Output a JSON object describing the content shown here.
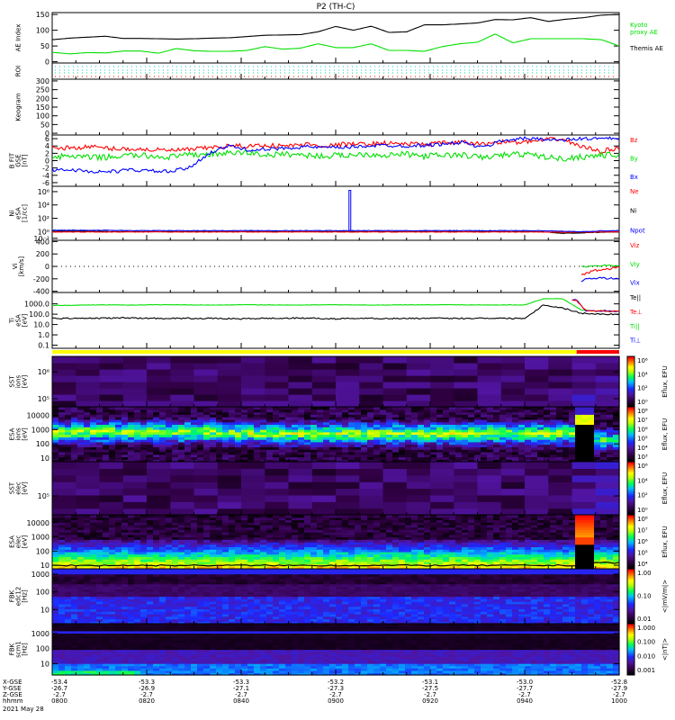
{
  "title": "P2 (TH-C)",
  "colors": {
    "red": "#ff0000",
    "green": "#00e000",
    "blue": "#0000ff",
    "black": "#000000",
    "yellow": "#ffff00",
    "cyan": "#00d0d0"
  },
  "chart_data": [
    {
      "id": "ae",
      "type": "line",
      "ylabel": "AE Index",
      "ylim": [
        -4,
        156
      ],
      "log": false,
      "ticks": [
        {
          "v": 0,
          "l": "0"
        },
        {
          "v": 50,
          "l": "50"
        },
        {
          "v": 100,
          "l": "100"
        },
        {
          "v": 150,
          "l": "150"
        }
      ],
      "legend": [
        {
          "name": "Kyoto proxy AE",
          "lines": [
            "Kyoto",
            "proxy AE"
          ],
          "color": "#00e000"
        },
        {
          "name": "Themis AE",
          "lines": [
            "Themis AE"
          ],
          "color": "#000000"
        }
      ],
      "series": [
        {
          "name": "Themis AE",
          "color": "#000000",
          "values": [
            70,
            75,
            78,
            81,
            74,
            74,
            73,
            72,
            73,
            75,
            76,
            80,
            84,
            85,
            86,
            95,
            112,
            100,
            113,
            93,
            95,
            117,
            117,
            120,
            123,
            134,
            133,
            140,
            128,
            135,
            140,
            148,
            150
          ]
        },
        {
          "name": "Kyoto proxy AE",
          "color": "#00e000",
          "values": [
            30,
            25,
            29,
            28,
            34,
            34,
            27,
            42,
            35,
            33,
            33,
            36,
            48,
            40,
            43,
            57,
            45,
            45,
            57,
            36,
            36,
            33,
            48,
            57,
            62,
            88,
            60,
            73,
            73,
            73,
            73,
            70,
            50
          ]
        }
      ]
    },
    {
      "id": "roi",
      "type": "line",
      "ylabel": "ROI",
      "ticks": []
    },
    {
      "id": "keo",
      "type": "line",
      "ylabel": "Keogram",
      "ylim": [
        -10,
        310
      ],
      "log": false,
      "ticks": [
        {
          "v": 0,
          "l": "0"
        },
        {
          "v": 50,
          "l": "50"
        },
        {
          "v": 100,
          "l": "100"
        },
        {
          "v": 150,
          "l": "150"
        },
        {
          "v": 200,
          "l": "200"
        },
        {
          "v": 250,
          "l": "250"
        },
        {
          "v": 300,
          "l": "300"
        }
      ],
      "series": []
    },
    {
      "id": "b",
      "type": "line",
      "ylabel": [
        "B FIT",
        "GSE",
        "[nT]"
      ],
      "ylim": [
        -7,
        7
      ],
      "log": false,
      "ticks": [
        {
          "v": -6,
          "l": "-6"
        },
        {
          "v": -4,
          "l": "-4"
        },
        {
          "v": -2,
          "l": "-2"
        },
        {
          "v": 0,
          "l": "0"
        },
        {
          "v": 2,
          "l": "2"
        },
        {
          "v": 4,
          "l": "4"
        },
        {
          "v": 6,
          "l": "6"
        }
      ],
      "legend": [
        {
          "name": "Bz",
          "lines": [
            "Bz"
          ],
          "color": "#ff0000"
        },
        {
          "name": "By",
          "lines": [
            "By"
          ],
          "color": "#00e000"
        },
        {
          "name": "Bx",
          "lines": [
            "Bx"
          ],
          "color": "#0000ff"
        }
      ],
      "series": [
        {
          "name": "Bz",
          "color": "#ff0000",
          "noise": 0.6,
          "values": [
            3.5,
            3.5,
            3.8,
            3.3,
            3.2,
            3.0,
            2.8,
            3.0,
            3.5,
            4.0,
            4.0,
            4.2,
            4.0,
            4.5,
            4.0,
            4.5,
            4.5,
            4.8,
            4.6,
            4.5,
            4.8,
            5.0,
            4.5,
            5.2,
            5.0,
            5.5,
            6.0,
            4.0,
            2.5,
            3.5
          ]
        },
        {
          "name": "By",
          "color": "#00e000",
          "noise": 0.8,
          "values": [
            1.0,
            1.2,
            0.8,
            1.0,
            1.5,
            1.2,
            1.0,
            1.5,
            1.8,
            2.0,
            2.2,
            1.5,
            1.8,
            1.5,
            1.2,
            1.5,
            1.8,
            1.5,
            1.8,
            1.2,
            1.5,
            1.5,
            0.8,
            1.5,
            1.8,
            1.2,
            0.5,
            1.0,
            1.5,
            1.5
          ]
        },
        {
          "name": "Bx",
          "color": "#0000ff",
          "noise": 0.5,
          "values": [
            -2.5,
            -2.5,
            -3.0,
            -3.0,
            -2.5,
            -2.8,
            -3.0,
            -2.0,
            2.0,
            4.0,
            3.0,
            3.0,
            3.5,
            3.8,
            3.5,
            3.6,
            4.0,
            4.2,
            4.0,
            4.2,
            4.5,
            5.0,
            3.5,
            5.5,
            6.0,
            6.0,
            5.5,
            6.0,
            6.0,
            6.0
          ]
        }
      ]
    },
    {
      "id": "ni",
      "type": "line",
      "ylabel": [
        "Ni",
        "eSA",
        "[1/cc]"
      ],
      "ylim": [
        -1.3,
        6.8
      ],
      "log": true,
      "ticks": [
        {
          "v": -1,
          "l": "10⁻¹"
        },
        {
          "v": 0,
          "l": "10⁰"
        },
        {
          "v": 2,
          "l": "10²"
        },
        {
          "v": 4,
          "l": "10⁴"
        },
        {
          "v": 6,
          "l": "10⁶"
        }
      ],
      "legend": [
        {
          "name": "Ne",
          "lines": [
            "Ne"
          ],
          "color": "#ff0000"
        },
        {
          "name": "Ni",
          "lines": [
            "Ni"
          ],
          "color": "#000000"
        },
        {
          "name": "Npot",
          "lines": [
            "Npot"
          ],
          "color": "#0000ff"
        }
      ],
      "series": [
        {
          "name": "Ni",
          "color": "#000000",
          "noise": 0.03,
          "values": [
            0.05,
            0.05,
            0.05,
            0.0,
            0.0,
            0.0,
            0.0,
            0.0,
            0.0,
            0.0,
            0.0,
            0.0,
            0.0,
            0.0,
            0.0,
            0.0,
            0.0,
            0.0,
            0.0,
            0.0,
            0.0,
            0.0,
            0.0,
            0.0,
            0.0,
            0.0,
            -0.25,
            -0.2,
            -0.1,
            -0.05
          ]
        },
        {
          "name": "Ne",
          "color": "#ff0000",
          "noise": 0.03,
          "values": [
            -0.05,
            -0.05,
            -0.05,
            -0.05,
            -0.05,
            -0.05,
            -0.05,
            -0.05,
            -0.05,
            -0.05,
            -0.05,
            -0.05,
            -0.05,
            -0.05,
            -0.05,
            -0.05,
            -0.05,
            -0.05,
            -0.05,
            -0.05,
            -0.05,
            -0.05,
            -0.05,
            -0.05,
            -0.05,
            -0.05,
            -0.1,
            -0.1,
            -0.05,
            -0.05
          ]
        },
        {
          "name": "Npot",
          "color": "#0000ff",
          "noise": 0.04,
          "values": [
            0.2,
            0.2,
            0.2,
            0.2,
            0.15,
            0.15,
            0.15,
            0.15,
            0.15,
            0.15,
            0.15,
            0.15,
            0.15,
            0.15,
            0.15,
            0.15,
            0.15,
            0.15,
            0.15,
            0.15,
            0.15,
            0.15,
            0.15,
            0.15,
            0.15,
            0.15,
            0.05,
            0.0,
            0.1,
            0.15
          ]
        },
        {
          "name": "Npot spike",
          "color": "#0000ff",
          "spike": {
            "t": 63,
            "v": 6.2,
            "base": 0.15
          }
        }
      ]
    },
    {
      "id": "vi",
      "type": "line",
      "ylabel": [
        "Vi",
        "[km/s]"
      ],
      "ylim": [
        -420,
        420
      ],
      "log": false,
      "ticks": [
        {
          "v": -400,
          "l": "-400"
        },
        {
          "v": -200,
          "l": "-200"
        },
        {
          "v": 0,
          "l": "0"
        },
        {
          "v": 200,
          "l": "200"
        },
        {
          "v": 400,
          "l": "400"
        }
      ],
      "legend": [
        {
          "name": "Viz",
          "lines": [
            "Viz"
          ],
          "color": "#ff0000"
        },
        {
          "name": "Viy",
          "lines": [
            "Viy"
          ],
          "color": "#00e000"
        },
        {
          "name": "Vix",
          "lines": [
            "Vix"
          ],
          "color": "#0000ff"
        }
      ],
      "series": [
        {
          "name": "Viz",
          "color": "#ff0000",
          "start": 112,
          "noise": 20,
          "values": [
            -150,
            -120,
            -100,
            -60,
            -80,
            -40,
            -50,
            -30,
            -20,
            -10
          ]
        },
        {
          "name": "Viy",
          "color": "#00e000",
          "start": 112,
          "noise": 10,
          "values": [
            0,
            -10,
            5,
            10,
            0,
            10,
            20,
            15,
            10,
            20
          ]
        },
        {
          "name": "Vix",
          "color": "#0000ff",
          "start": 112,
          "noise": 10,
          "values": [
            -250,
            -200,
            -190,
            -200,
            -190,
            -180,
            -200,
            -190,
            -200,
            -200
          ]
        }
      ]
    },
    {
      "id": "ti",
      "type": "line",
      "ylabel": [
        "Ti",
        "eSA",
        "[eV]"
      ],
      "ylim": [
        -1.3,
        4.1
      ],
      "log": true,
      "ticks": [
        {
          "v": -1,
          "l": "0.1"
        },
        {
          "v": 0,
          "l": "1.0"
        },
        {
          "v": 1,
          "l": "10.0"
        },
        {
          "v": 2,
          "l": "100.0"
        },
        {
          "v": 3,
          "l": "1000.0"
        }
      ],
      "legend": [
        {
          "name": "Te||",
          "lines": [
            "Te||"
          ],
          "color": "#000000"
        },
        {
          "name": "Te⊥",
          "lines": [
            "Te⊥"
          ],
          "color": "#ff0000"
        },
        {
          "name": "Ti||",
          "lines": [
            "Ti||"
          ],
          "color": "#00e000"
        },
        {
          "name": "Ti⊥",
          "lines": [
            "Ti⊥"
          ],
          "color": "#0000ff"
        }
      ],
      "series": [
        {
          "name": "Ti||",
          "color": "#00e000",
          "noise": 0.02,
          "values": [
            2.85,
            2.85,
            2.9,
            2.9,
            2.88,
            2.9,
            2.92,
            2.9,
            2.88,
            2.9,
            2.92,
            2.9,
            2.9,
            2.88,
            2.9,
            2.92,
            2.9,
            2.88,
            2.9,
            2.9,
            2.9,
            2.92,
            2.9,
            2.9,
            2.9,
            2.9,
            3.5,
            3.5,
            2.4,
            2.3,
            2.3
          ]
        },
        {
          "name": "Te||",
          "color": "#000000",
          "noise": 0.06,
          "values": [
            1.6,
            1.6,
            1.6,
            1.62,
            1.65,
            1.6,
            1.6,
            1.6,
            1.6,
            1.58,
            1.55,
            1.6,
            1.6,
            1.62,
            1.6,
            1.55,
            1.6,
            1.6,
            1.58,
            1.6,
            1.6,
            1.6,
            1.6,
            1.62,
            1.6,
            1.6,
            2.9,
            2.6,
            2.1,
            2.0,
            2.0
          ]
        },
        {
          "name": "Ti⊥",
          "color": "#0000ff",
          "start": 110,
          "noise": 0.04,
          "values": [
            3.4,
            3.4,
            2.8,
            2.3,
            2.35,
            2.3,
            2.3,
            2.35,
            2.3,
            2.25,
            2.3
          ]
        },
        {
          "name": "Te⊥",
          "color": "#ff0000",
          "start": 110,
          "noise": 0.04,
          "values": [
            3.4,
            3.3,
            2.8,
            2.35,
            2.3,
            2.3,
            2.35,
            2.3,
            2.25,
            2.3,
            2.3
          ]
        }
      ]
    },
    {
      "id": "sst_i",
      "type": "heatmap",
      "ylabel": [
        "SST",
        "ions",
        "[eV]"
      ],
      "ylim": [
        4.7,
        6.57
      ],
      "log": true,
      "ticks": [
        {
          "v": 5,
          "l": "10⁵"
        },
        {
          "v": 6,
          "l": "10⁶"
        }
      ]
    },
    {
      "id": "esa_i",
      "type": "heatmap",
      "ylabel": [
        "ESA",
        "ions",
        "[eV]"
      ],
      "ylim": [
        0.75,
        4.6
      ],
      "log": true,
      "ticks": [
        {
          "v": 1,
          "l": "10"
        },
        {
          "v": 2,
          "l": "100"
        },
        {
          "v": 3,
          "l": "1000"
        },
        {
          "v": 4,
          "l": "10000"
        }
      ]
    },
    {
      "id": "sst_e",
      "type": "heatmap",
      "ylabel": [
        "SST",
        "elec",
        "[eV]"
      ],
      "ylim": [
        4.3,
        6.27
      ],
      "log": true,
      "ticks": [
        {
          "v": 5,
          "l": "10⁵"
        }
      ]
    },
    {
      "id": "esa_e",
      "type": "heatmap",
      "ylabel": [
        "ESA",
        "elec",
        "[eV]"
      ],
      "ylim": [
        0.75,
        4.56
      ],
      "log": true,
      "ticks": [
        {
          "v": 1,
          "l": "10"
        },
        {
          "v": 2,
          "l": "100"
        },
        {
          "v": 3,
          "l": "1000"
        },
        {
          "v": 4,
          "l": "10000"
        }
      ]
    },
    {
      "id": "fbk1",
      "type": "heatmap",
      "ylabel": [
        "FBK",
        "edc12",
        "[Hz]"
      ],
      "ylim": [
        0.2,
        3.3
      ],
      "log": true,
      "ticks": [
        {
          "v": 1,
          "l": "10"
        },
        {
          "v": 2,
          "l": "100"
        },
        {
          "v": 3,
          "l": "1000"
        }
      ]
    },
    {
      "id": "fbk2",
      "type": "heatmap",
      "ylabel": [
        "FBK",
        "scm1",
        "[Hz]"
      ],
      "ylim": [
        0.25,
        3.65
      ],
      "log": true,
      "ticks": [
        {
          "v": 1,
          "l": "10"
        },
        {
          "v": 2,
          "l": "100"
        },
        {
          "v": 3,
          "l": "1000"
        }
      ]
    }
  ],
  "colorbars": [
    {
      "title": "Eflux, EFU",
      "labels": [
        "10⁰",
        "10²",
        "10⁴",
        "10⁶"
      ]
    },
    {
      "title": "Eflux, EFU",
      "labels": [
        "10³",
        "10⁴",
        "10⁵",
        "10⁶",
        "10⁷",
        "10⁸"
      ]
    },
    {
      "title": "Eflux, EFU",
      "labels": [
        "10⁰",
        "10²",
        "10⁴",
        "10⁶"
      ]
    },
    {
      "title": "Eflux, EFU",
      "labels": [
        "10⁴",
        "10⁵",
        "10⁶",
        "10⁷",
        "10⁸"
      ]
    },
    {
      "title": "<|mV/m|>",
      "labels": [
        "0.01",
        "0.10",
        "1.00"
      ]
    },
    {
      "title": "<|nT|>",
      "labels": [
        "0.001",
        "0.010",
        "0.100",
        "1.000"
      ]
    }
  ],
  "state_bar": [
    {
      "from": 0,
      "to": 111,
      "color": "#ffff00"
    },
    {
      "from": 111,
      "to": 120,
      "color": "#ff0000"
    }
  ],
  "x_axis": {
    "row_labels": [
      "X-GSE",
      "Y-GSE",
      "Z-GSE",
      "hhmm"
    ],
    "date": "2021 May 28",
    "ticks": [
      {
        "t": 0,
        "x": "-53.4",
        "y": "-26.7",
        "z": "-2.7",
        "hhmm": "0800"
      },
      {
        "t": 20,
        "x": "-53.3",
        "y": "-26.9",
        "z": "-2.7",
        "hhmm": "0820"
      },
      {
        "t": 40,
        "x": "-53.3",
        "y": "-27.1",
        "z": "-2.7",
        "hhmm": "0840"
      },
      {
        "t": 60,
        "x": "-53.2",
        "y": "-27.3",
        "z": "-2.7",
        "hhmm": "0900"
      },
      {
        "t": 80,
        "x": "-53.1",
        "y": "-27.5",
        "z": "-2.7",
        "hhmm": "0920"
      },
      {
        "t": 100,
        "x": "-53.0",
        "y": "-27.7",
        "z": "-2.7",
        "hhmm": "0940"
      },
      {
        "t": 120,
        "x": "-52.8",
        "y": "-27.9",
        "z": "-2.7",
        "hhmm": "1000"
      }
    ]
  }
}
